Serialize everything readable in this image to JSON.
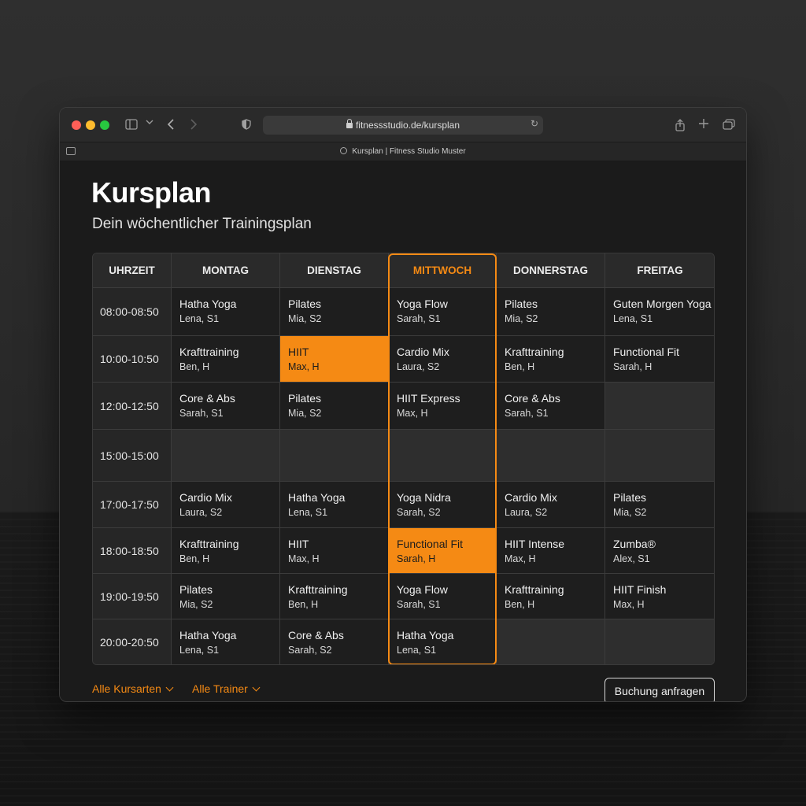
{
  "browser": {
    "url": "fitnessstudio.de/kursplan",
    "tab_title": "Kursplan | Fitness Studio Muster"
  },
  "page": {
    "title": "Kursplan",
    "subtitle": "Dein wöchentlicher Trainingsplan"
  },
  "schedule": {
    "time_header": "UHRZEIT",
    "days": [
      "MONTAG",
      "DIENSTAG",
      "MITTWOCH",
      "DONNERSTAG",
      "FREITAG"
    ],
    "current_day": "MITTWOCH",
    "rows": [
      {
        "time": "08:00-08:50",
        "cells": [
          {
            "name": "Hatha Yoga",
            "trainer": "Lena, S1"
          },
          {
            "name": "Pilates",
            "trainer": "Mia, S2"
          },
          {
            "name": "Yoga Flow",
            "trainer": "Sarah, S1"
          },
          {
            "name": "Pilates",
            "trainer": "Mia, S2"
          },
          {
            "name": "Guten Morgen Yoga",
            "trainer": "Lena, S1"
          }
        ]
      },
      {
        "time": "10:00-10:50",
        "cells": [
          {
            "name": "Krafttraining",
            "trainer": "Ben, H"
          },
          {
            "name": "HIIT",
            "trainer": "Max, H",
            "highlight": true
          },
          {
            "name": "Cardio Mix",
            "trainer": "Laura, S2"
          },
          {
            "name": "Krafttraining",
            "trainer": "Ben, H"
          },
          {
            "name": "Functional Fit",
            "trainer": "Sarah, H"
          }
        ]
      },
      {
        "time": "12:00-12:50",
        "cells": [
          {
            "name": "Core & Abs",
            "trainer": "Sarah, S1"
          },
          {
            "name": "Pilates",
            "trainer": "Mia, S2"
          },
          {
            "name": "HIIT Express",
            "trainer": "Max, H"
          },
          {
            "name": "Core & Abs",
            "trainer": "Sarah, S1"
          },
          null
        ]
      },
      {
        "time": "15:00-15:00",
        "cells": [
          null,
          null,
          null,
          null,
          null
        ]
      },
      {
        "time": "17:00-17:50",
        "cells": [
          {
            "name": "Cardio Mix",
            "trainer": "Laura, S2"
          },
          {
            "name": "Hatha Yoga",
            "trainer": "Lena, S1"
          },
          {
            "name": "Yoga Nidra",
            "trainer": "Sarah, S2"
          },
          {
            "name": "Cardio Mix",
            "trainer": "Laura, S2"
          },
          {
            "name": "Pilates",
            "trainer": "Mia, S2"
          }
        ]
      },
      {
        "time": "18:00-18:50",
        "cells": [
          {
            "name": "Krafttraining",
            "trainer": "Ben, H"
          },
          {
            "name": "HIIT",
            "trainer": "Max, H"
          },
          {
            "name": "Functional Fit",
            "trainer": "Sarah, H",
            "highlight": true
          },
          {
            "name": "HIIT Intense",
            "trainer": "Max, H"
          },
          {
            "name": "Zumba®",
            "trainer": "Alex, S1"
          }
        ]
      },
      {
        "time": "19:00-19:50",
        "cells": [
          {
            "name": "Pilates",
            "trainer": "Mia, S2"
          },
          {
            "name": "Krafttraining",
            "trainer": "Ben, H"
          },
          {
            "name": "Yoga Flow",
            "trainer": "Sarah, S1"
          },
          {
            "name": "Krafttraining",
            "trainer": "Ben, H"
          },
          {
            "name": "HIIT Finish",
            "trainer": "Max, H"
          }
        ]
      },
      {
        "time": "20:00-20:50",
        "cells": [
          {
            "name": "Hatha Yoga",
            "trainer": "Lena, S1"
          },
          {
            "name": "Core & Abs",
            "trainer": "Sarah, S2"
          },
          {
            "name": "Hatha Yoga",
            "trainer": "Lena, S1"
          },
          null,
          null
        ]
      }
    ]
  },
  "filters": {
    "course_types": "Alle Kursarten",
    "trainers": "Alle Trainer"
  },
  "actions": {
    "book": "Buchung anfragen"
  },
  "colors": {
    "accent": "#f58a14",
    "background": "#1b1b1b"
  }
}
